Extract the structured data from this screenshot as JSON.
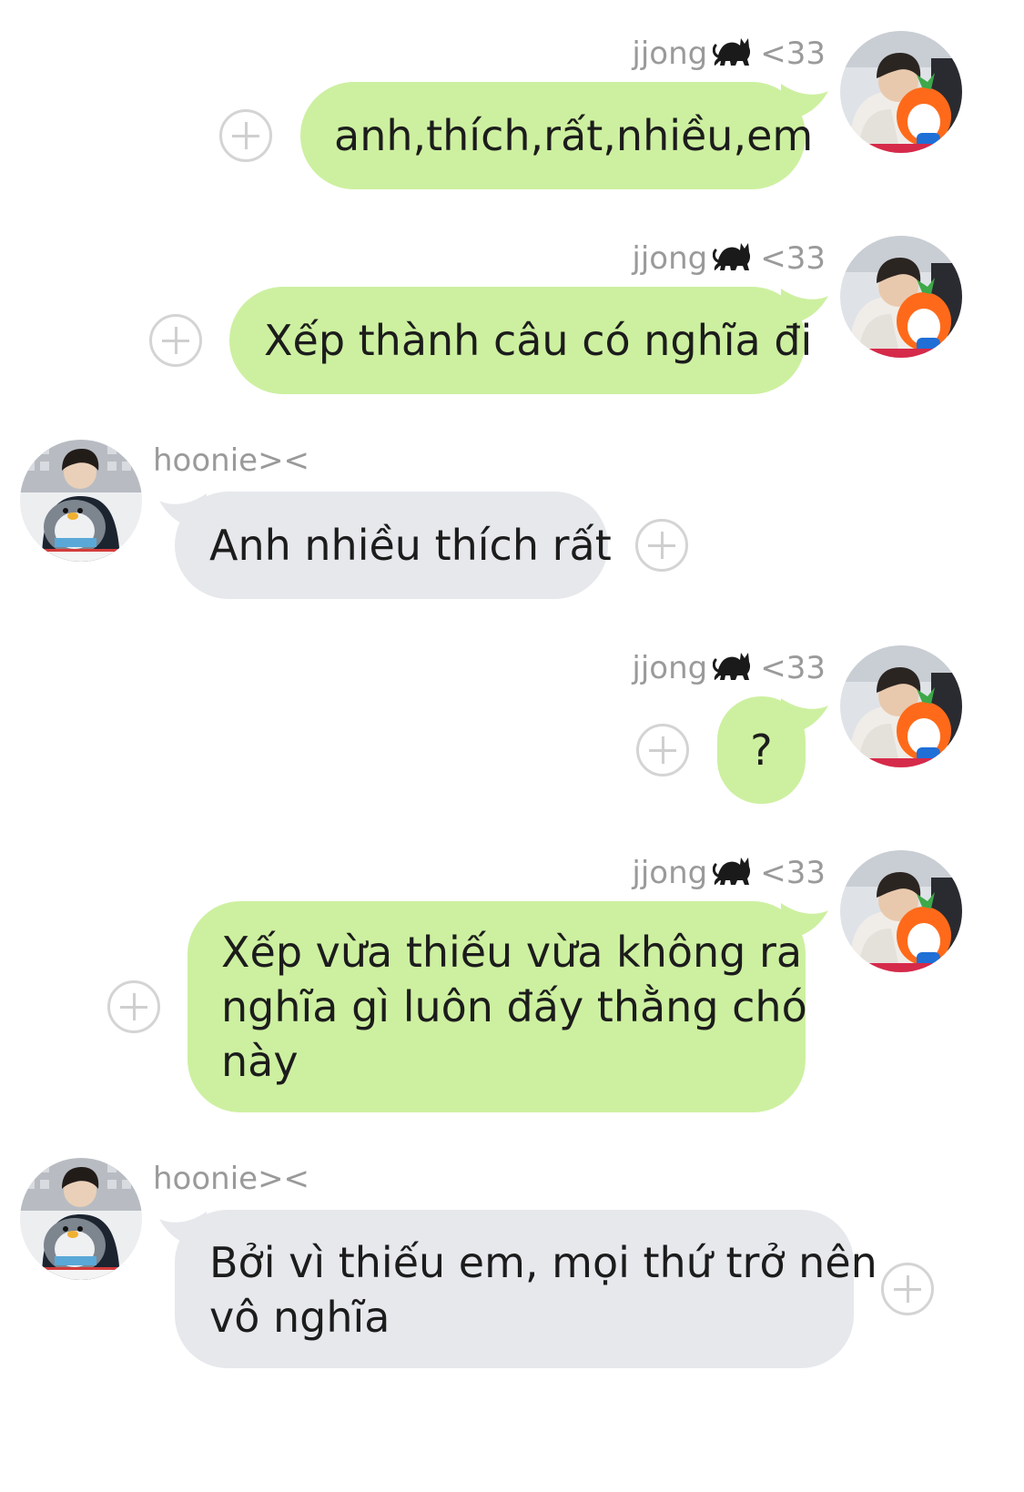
{
  "chat": {
    "sender_me": {
      "name": "jjong",
      "name_suffix": "<33",
      "name_icon": "black-cat-icon"
    },
    "sender_other": {
      "name": "hoonie><"
    },
    "messages": [
      {
        "from": "me",
        "text": "anh,thích,rất,nhiều,em"
      },
      {
        "from": "me",
        "text": "Xếp thành câu có nghĩa đi"
      },
      {
        "from": "other",
        "text": "Anh nhiều thích rất"
      },
      {
        "from": "me",
        "text": "?"
      },
      {
        "from": "me",
        "lines": [
          "Xếp vừa thiếu vừa không ra",
          "nghĩa gì luôn đấy thằng chó",
          "này"
        ]
      },
      {
        "from": "other",
        "lines": [
          "Bởi vì thiếu em, mọi thứ trở nên",
          "vô nghĩa"
        ]
      }
    ]
  },
  "colors": {
    "sent_bubble": "#cdf0a0",
    "received_bubble": "#e6e8ec",
    "name_text": "#9a9a9a",
    "message_text": "#1c1c1c"
  }
}
